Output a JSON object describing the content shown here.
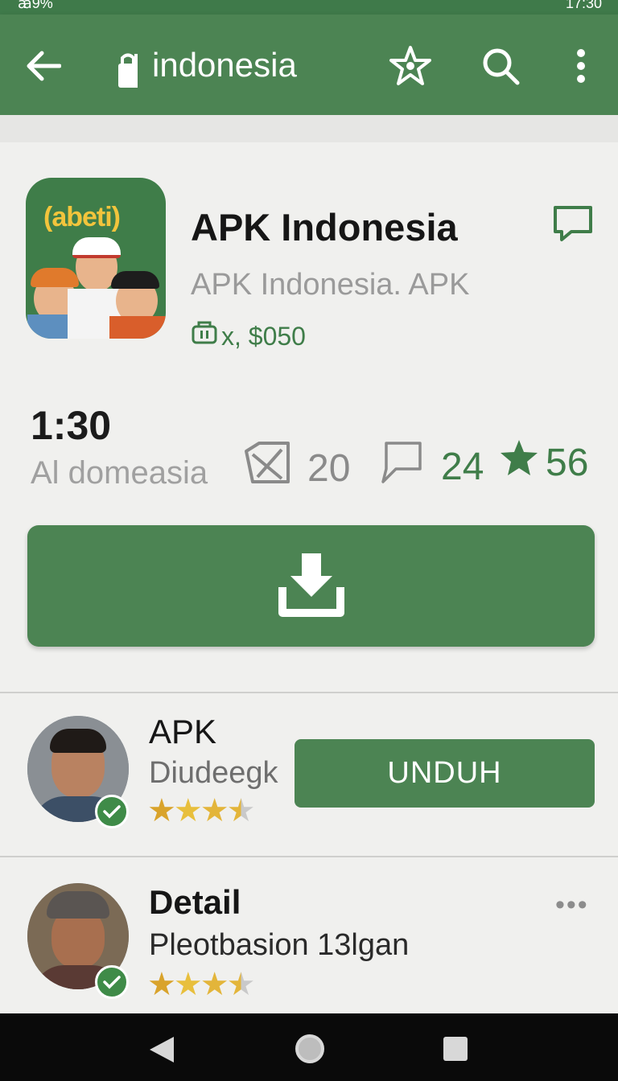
{
  "status_bar": {
    "left": "ꜳ9%",
    "right": "17:30"
  },
  "toolbar": {
    "title": "indonesia",
    "icons": [
      "back-arrow-icon",
      "lock-icon",
      "star-icon",
      "search-icon",
      "more-vert-icon"
    ]
  },
  "app": {
    "name": "APK Indonesia",
    "subtitle": "APK Indonesia. APK",
    "price": "x, $050",
    "icon_brand": "(abeti)",
    "accent": "#4c8453"
  },
  "stats": {
    "time": "1:30",
    "location": "Al domeasia",
    "count_a": "20",
    "count_b": "24",
    "rating": "56"
  },
  "download_button": {
    "icon": "download-icon"
  },
  "list": [
    {
      "title": "APK",
      "subtitle": "Diudeegk",
      "rating": 3.5,
      "action": "UNDUH"
    },
    {
      "title": "Detail",
      "subtitle": "Pleotbasion 13lgan",
      "rating": 3.5,
      "more": "•••"
    }
  ]
}
